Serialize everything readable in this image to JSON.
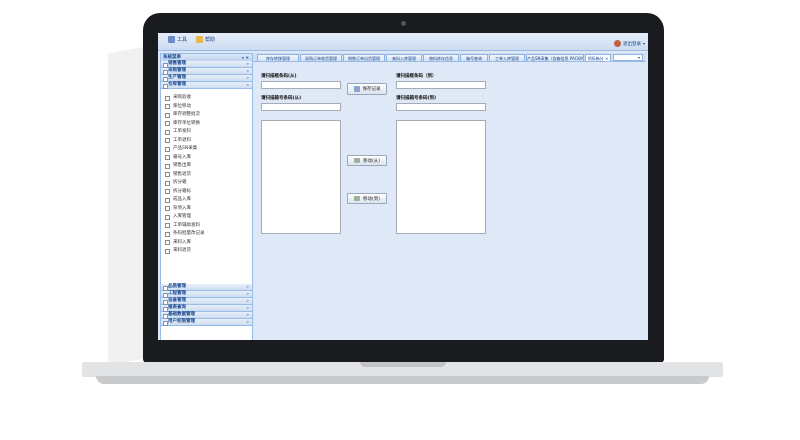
{
  "toolbar": {
    "tools_label": "工具",
    "help_label": "帮助"
  },
  "user": {
    "label": "退出登录"
  },
  "sidebar": {
    "title": "系统菜单",
    "groups_top": [
      {
        "label": "销售管理"
      },
      {
        "label": "采购管理"
      },
      {
        "label": "生产管理"
      },
      {
        "label": "仓库管理"
      }
    ],
    "items": [
      {
        "label": "采购验收"
      },
      {
        "label": "库位移动"
      },
      {
        "label": "库存调整批次"
      },
      {
        "label": "库存单位转换"
      },
      {
        "label": "工单发料"
      },
      {
        "label": "工单退料"
      },
      {
        "label": "产品SN采集"
      },
      {
        "label": "箱号入库"
      },
      {
        "label": "销售出库"
      },
      {
        "label": "销售退货"
      },
      {
        "label": "拆分箱"
      },
      {
        "label": "拆分箱标"
      },
      {
        "label": "成品入库"
      },
      {
        "label": "杂项入库"
      },
      {
        "label": "入库管理"
      },
      {
        "label": "工单辅助发料"
      },
      {
        "label": "条码批量改记录"
      },
      {
        "label": "来料入库"
      },
      {
        "label": "来料退货"
      }
    ],
    "groups_bottom": [
      {
        "label": "品质管理"
      },
      {
        "label": "工程管理"
      },
      {
        "label": "设备管理"
      },
      {
        "label": "报表查询"
      },
      {
        "label": "基础数据管理"
      },
      {
        "label": "用户权限管理"
      }
    ]
  },
  "tabs": [
    {
      "label": "库存转移管理"
    },
    {
      "label": "采购订单收货管理"
    },
    {
      "label": "销售订单出货管理"
    },
    {
      "label": "来料入库管理"
    },
    {
      "label": "物料库存信息"
    },
    {
      "label": "箱号查询"
    },
    {
      "label": "工单入库管理"
    },
    {
      "label": "产品SN采集（含箱信息 PACKING）"
    },
    {
      "label": "领拆箱分"
    }
  ],
  "form": {
    "left_label_top": "请扫描框条码(从)",
    "left_label_list": "请扫描箱号条码(从)",
    "right_label_top": "请扫描框条码（到）",
    "right_label_list": "请扫描箱号条码(到)",
    "save_button": "保存记录",
    "move_right_button": "移动(从)",
    "move_left_button": "移动(到)"
  }
}
